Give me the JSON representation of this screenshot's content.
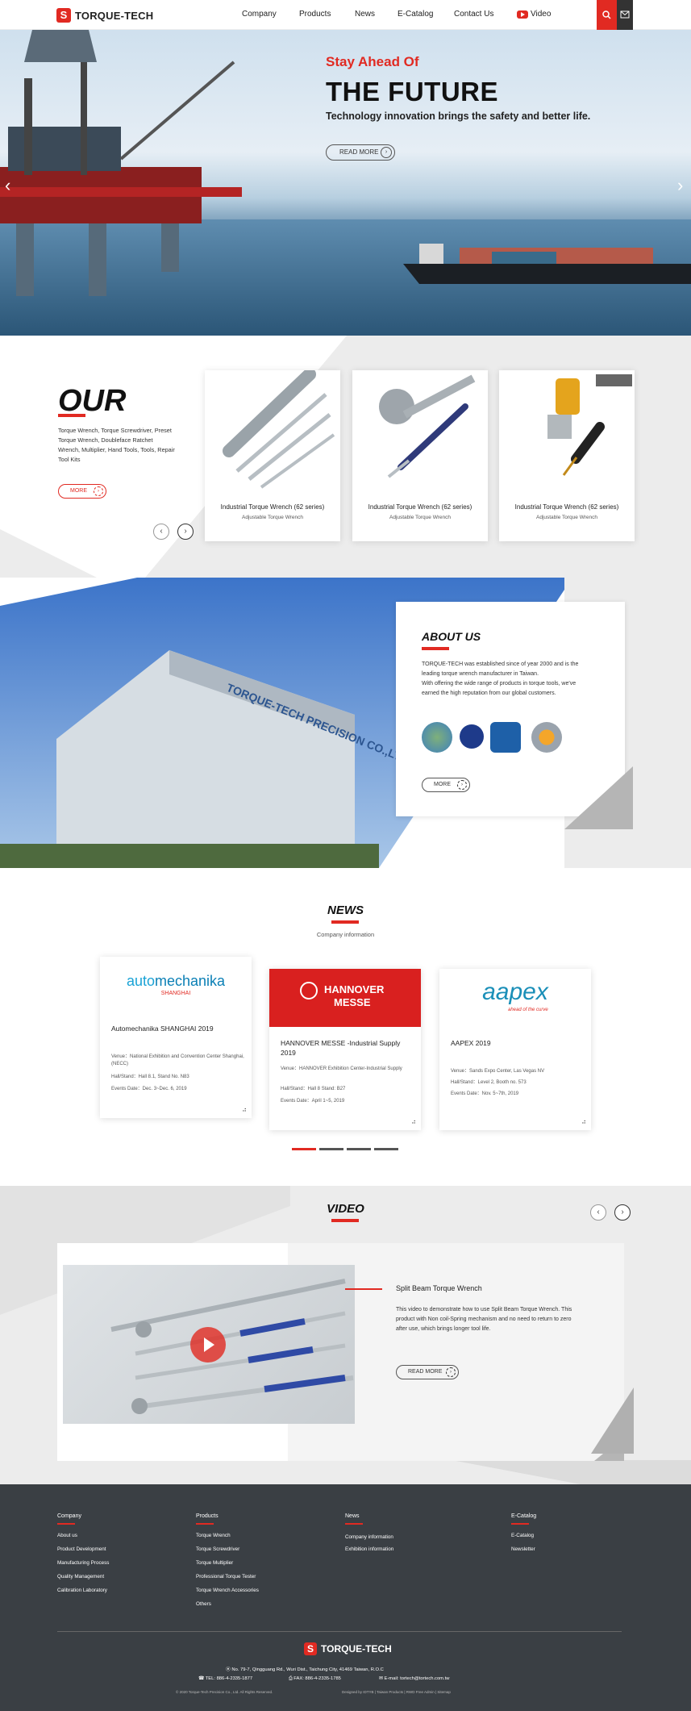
{
  "header": {
    "logo_text": "TORQUE-TECH",
    "nav": [
      "Company",
      "Products",
      "News",
      "E-Catalog",
      "Contact Us",
      "Video"
    ]
  },
  "hero": {
    "eyebrow": "Stay Ahead Of",
    "title": "THE FUTURE",
    "subtitle": "Technology innovation brings the safety and better life.",
    "button": "READ MORE"
  },
  "products": {
    "title": "OUR",
    "description": "Torque Wrench, Torque Screwdriver, Preset Torque Wrench, Doubleface Ratchet Wrench, Multiplier, Hand Tools, Tools, Repair Tool Kits",
    "more": "MORE",
    "items": [
      {
        "name": "Industrial Torque Wrench (62 series)",
        "sub": "Adjustable Torque Wrench"
      },
      {
        "name": "Industrial Torque Wrench (62 series)",
        "sub": "Adjustable Torque Wrench"
      },
      {
        "name": "Industrial Torque Wrench (62 series)",
        "sub": "Adjustable Torque Wrench"
      }
    ]
  },
  "about": {
    "title": "ABOUT US",
    "body": "TORQUE-TECH was established since of year 2000 and is the leading torque wrench manufacturer in Taiwan.\nWith offering the wide range of products in torque tools, we've earned the high reputation from our global customers.",
    "more": "MORE",
    "sign_text": "TORQUE-TECH PRECISION CO.,LTD"
  },
  "news": {
    "title": "NEWS",
    "subtitle": "Company information",
    "items": [
      {
        "logo_a": "auto",
        "logo_b": "mechanika",
        "logo_c": "SHANGHAI",
        "title": "Automechanika SHANGHAI 2019",
        "venue": "Venue：National Exhibition and Convention Center Shanghai, (NECC)",
        "hall": "Hall/Stand：Hall 8.1, Stand No. N83",
        "date": "Events Date：Dec. 3~Dec. 6, 2019"
      },
      {
        "logo_a": "HANNOVER",
        "logo_b": "MESSE",
        "title": "HANNOVER MESSE -Industrial Supply 2019",
        "venue": "Venue：HANNOVER Exhibition Center-Industrial Supply",
        "hall": "Hall/Stand：Hall 8 Stand: B27",
        "date": "Events Date：April 1~5, 2019"
      },
      {
        "logo_a": "aapex",
        "logo_b": "ahead of the curve",
        "title": "AAPEX 2019",
        "venue": "Venue：Sands Expo Center, Las Vegas NV",
        "hall": "Hall/Stand：Level 2, Booth no. 573",
        "date": "Events Date：Nov. 5~7th, 2019"
      }
    ]
  },
  "video": {
    "title": "VIDEO",
    "name": "Split Beam Torque Wrench",
    "desc": "This video to demonstrate how to use Split Beam Torque Wrench. This product with Non coil-Spring mechanism and no need to return to zero after use, which brings longer tool life.",
    "button": "READ MORE"
  },
  "footer": {
    "cols": [
      {
        "head": "Company",
        "links": [
          "About us",
          "Product Development",
          "Manufacturing Process",
          "Quality Management",
          "Calibration Laboratory"
        ]
      },
      {
        "head": "Products",
        "links": [
          "Torque Wrench",
          "Torque Screwdriver",
          "Torque Multiplier",
          "Professional Torque Tester",
          "Torque Wrench Accessories",
          "Others"
        ]
      },
      {
        "head": "News",
        "links": [
          "Company information",
          "Exhibition information"
        ]
      },
      {
        "head": "E-Catalog",
        "links": [
          "E-Catalog",
          "Newsletter"
        ]
      }
    ],
    "logo_text": "TORQUE-TECH",
    "address": "No. 79-7, Qingguang Rd., Wuri Dist., Taichung City, 41469 Taiwan, R.O.C",
    "tel": "TEL: 886-4-2335-1877",
    "fax": "FAX: 886-4-2335-1785",
    "email": "E-mail: tortech@tortech.com.tw",
    "copyright": "© 2020 Torque-Tech Precision Co., Ltd. All Rights Reserved.",
    "credits": "Designed by IDTYB | Taiwan Products | RWD Free Admin | Sitemap"
  }
}
